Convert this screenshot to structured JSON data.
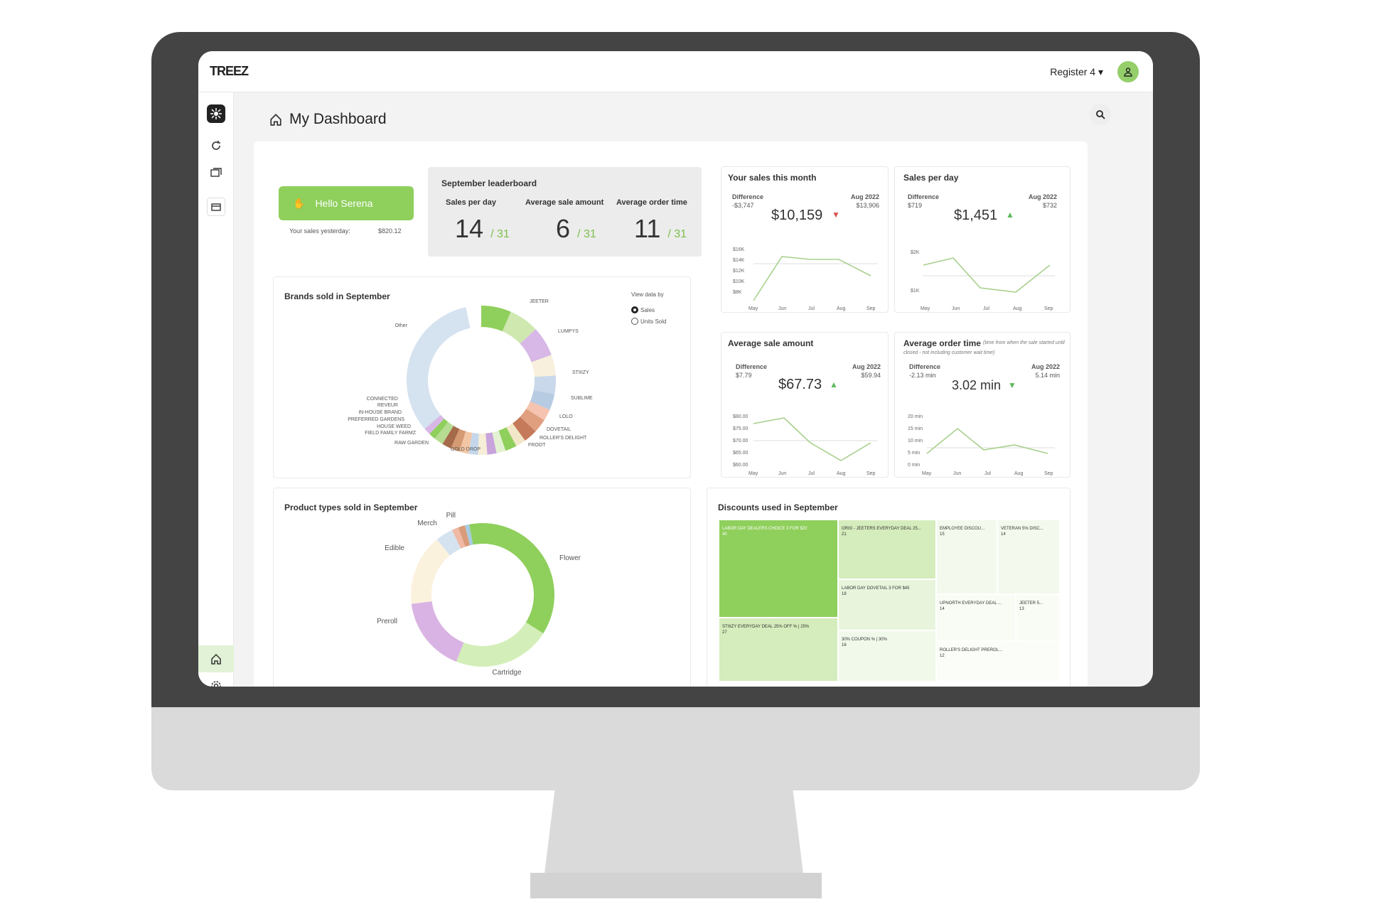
{
  "app": {
    "logo": "TREEZ",
    "register": "Register 4 ▾"
  },
  "page": {
    "title": "My Dashboard"
  },
  "greeting": {
    "button": "Hello Serena",
    "yesterday_label": "Your sales yesterday:",
    "yesterday_value": "$820.12"
  },
  "leaderboard": {
    "title": "September leaderboard",
    "items": [
      {
        "label": "Sales per day",
        "rank": "14",
        "of": "/ 31"
      },
      {
        "label": "Average sale amount",
        "rank": "6",
        "of": "/ 31"
      },
      {
        "label": "Average order time",
        "rank": "11",
        "of": "/ 31"
      }
    ]
  },
  "kpis": {
    "sales_month": {
      "title": "Your sales this month",
      "diff_label": "Difference",
      "diff": "-$3,747",
      "value": "$10,159",
      "cmp_label": "Aug 2022",
      "cmp": "$13,906",
      "trend": "down",
      "yticks": [
        "$16K",
        "$14K",
        "$12K",
        "$10K",
        "$8K"
      ],
      "xticks": [
        "May",
        "Jun",
        "Jul",
        "Aug",
        "Sep"
      ]
    },
    "sales_day": {
      "title": "Sales per day",
      "diff_label": "Difference",
      "diff": "$719",
      "value": "$1,451",
      "cmp_label": "Aug 2022",
      "cmp": "$732",
      "trend": "up",
      "yticks": [
        "$2K",
        "$1K"
      ],
      "xticks": [
        "May",
        "Jun",
        "Jul",
        "Aug",
        "Sep"
      ]
    },
    "avg_sale": {
      "title": "Average sale amount",
      "diff_label": "Difference",
      "diff": "$7.79",
      "value": "$67.73",
      "cmp_label": "Aug 2022",
      "cmp": "$59.94",
      "trend": "up",
      "yticks": [
        "$80.00",
        "$75.00",
        "$70.00",
        "$65.00",
        "$60.00"
      ],
      "xticks": [
        "May",
        "Jun",
        "Jul",
        "Aug",
        "Sep"
      ]
    },
    "avg_order": {
      "title": "Average order time",
      "subtitle": "(time from when the sale started until closed - not including customer wait time)",
      "diff_label": "Difference",
      "diff": "-2.13 min",
      "value": "3.02 min",
      "cmp_label": "Aug 2022",
      "cmp": "5.14 min",
      "trend": "down",
      "yticks": [
        "20 min",
        "15 min",
        "10 min",
        "5 min",
        "0 min"
      ],
      "xticks": [
        "May",
        "Jun",
        "Jul",
        "Aug",
        "Sep"
      ]
    }
  },
  "brands": {
    "title": "Brands sold in September",
    "view_label": "View data by",
    "options": [
      "Sales",
      "Units Sold"
    ],
    "selected": "Sales",
    "labels": [
      "JEETER",
      "LUMPYS",
      "STIIIZY",
      "SUBLIME",
      "LOLO",
      "DOVETAIL",
      "ROLLER'S DELIGHT",
      "FROOT",
      "GOLD DROP",
      "RAW GARDEN",
      "FIELD FAMILY FARMZ",
      "HOUSE WEED",
      "PREFERRED GARDENS",
      "IN-HOUSE BRAND",
      "REVEUR",
      "CONNECTED",
      "Other"
    ]
  },
  "product_types": {
    "title": "Product types sold in September",
    "labels": [
      "Flower",
      "Cartridge",
      "Preroll",
      "Edible",
      "Merch",
      "Pill"
    ]
  },
  "discounts": {
    "title": "Discounts used in September",
    "cells": [
      {
        "name": "LABOR DAY DEALERS CHOICE 3 FOR $20",
        "count": "40"
      },
      {
        "name": "STIIIZY EVERYDAY DEAL 25% OFF % | 25%",
        "count": "27"
      },
      {
        "name": "ORIG - JEETERS EVERYDAY DEAL 25...",
        "count": "21"
      },
      {
        "name": "LABOR DAY DOVETAIL 3 FOR $45",
        "count": "18"
      },
      {
        "name": "30% COUPON % | 30%",
        "count": "16"
      },
      {
        "name": "EMPLOYEE DISCOU...",
        "count": "15"
      },
      {
        "name": "VETERAN 5% DISC...",
        "count": "14"
      },
      {
        "name": "UPNORTH EVERYDAY DEAL ...",
        "count": "14"
      },
      {
        "name": "JEETER 5...",
        "count": "13"
      },
      {
        "name": "ROLLER'S DELIGHT PREROL...",
        "count": "12"
      }
    ]
  },
  "colors": {
    "accent": "#8fcf5c",
    "up": "#5cb85c",
    "down": "#d9534f"
  }
}
